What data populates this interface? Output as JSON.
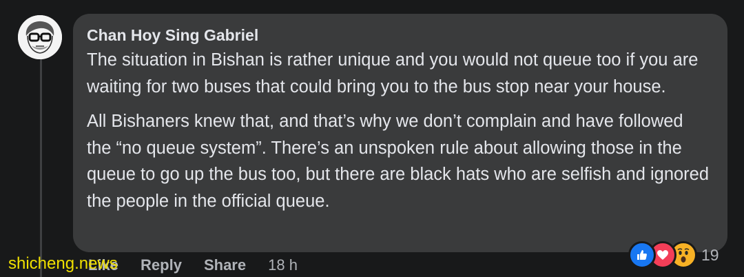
{
  "comment": {
    "author": "Chan Hoy Sing Gabriel",
    "paragraphs": [
      "The situation in Bishan is rather unique and you would not queue too if you are waiting for two buses that could bring you to the bus stop near your house.",
      "All Bishaners knew that, and that’s why we don’t complain and have followed the “no queue system”. There’s an unspoken rule about allowing those in the queue to go up the bus too, but there are black hats who are selfish and ignored the people in the official queue."
    ],
    "reactions": {
      "icons": [
        "like-icon",
        "love-icon",
        "wow-icon"
      ],
      "count": "19"
    },
    "actions": {
      "like": "Like",
      "reply": "Reply",
      "share": "Share",
      "time": "18 h"
    }
  },
  "watermark": "shicheng.news",
  "colors": {
    "background": "#18191a",
    "bubble": "#3a3b3c",
    "text": "#e4e6eb",
    "secondary_text": "#b0b3b8",
    "like_blue": "#1877f2",
    "love_red": "#f33e58",
    "wow_yellow": "#f7b125",
    "watermark_yellow": "#f0e000"
  }
}
